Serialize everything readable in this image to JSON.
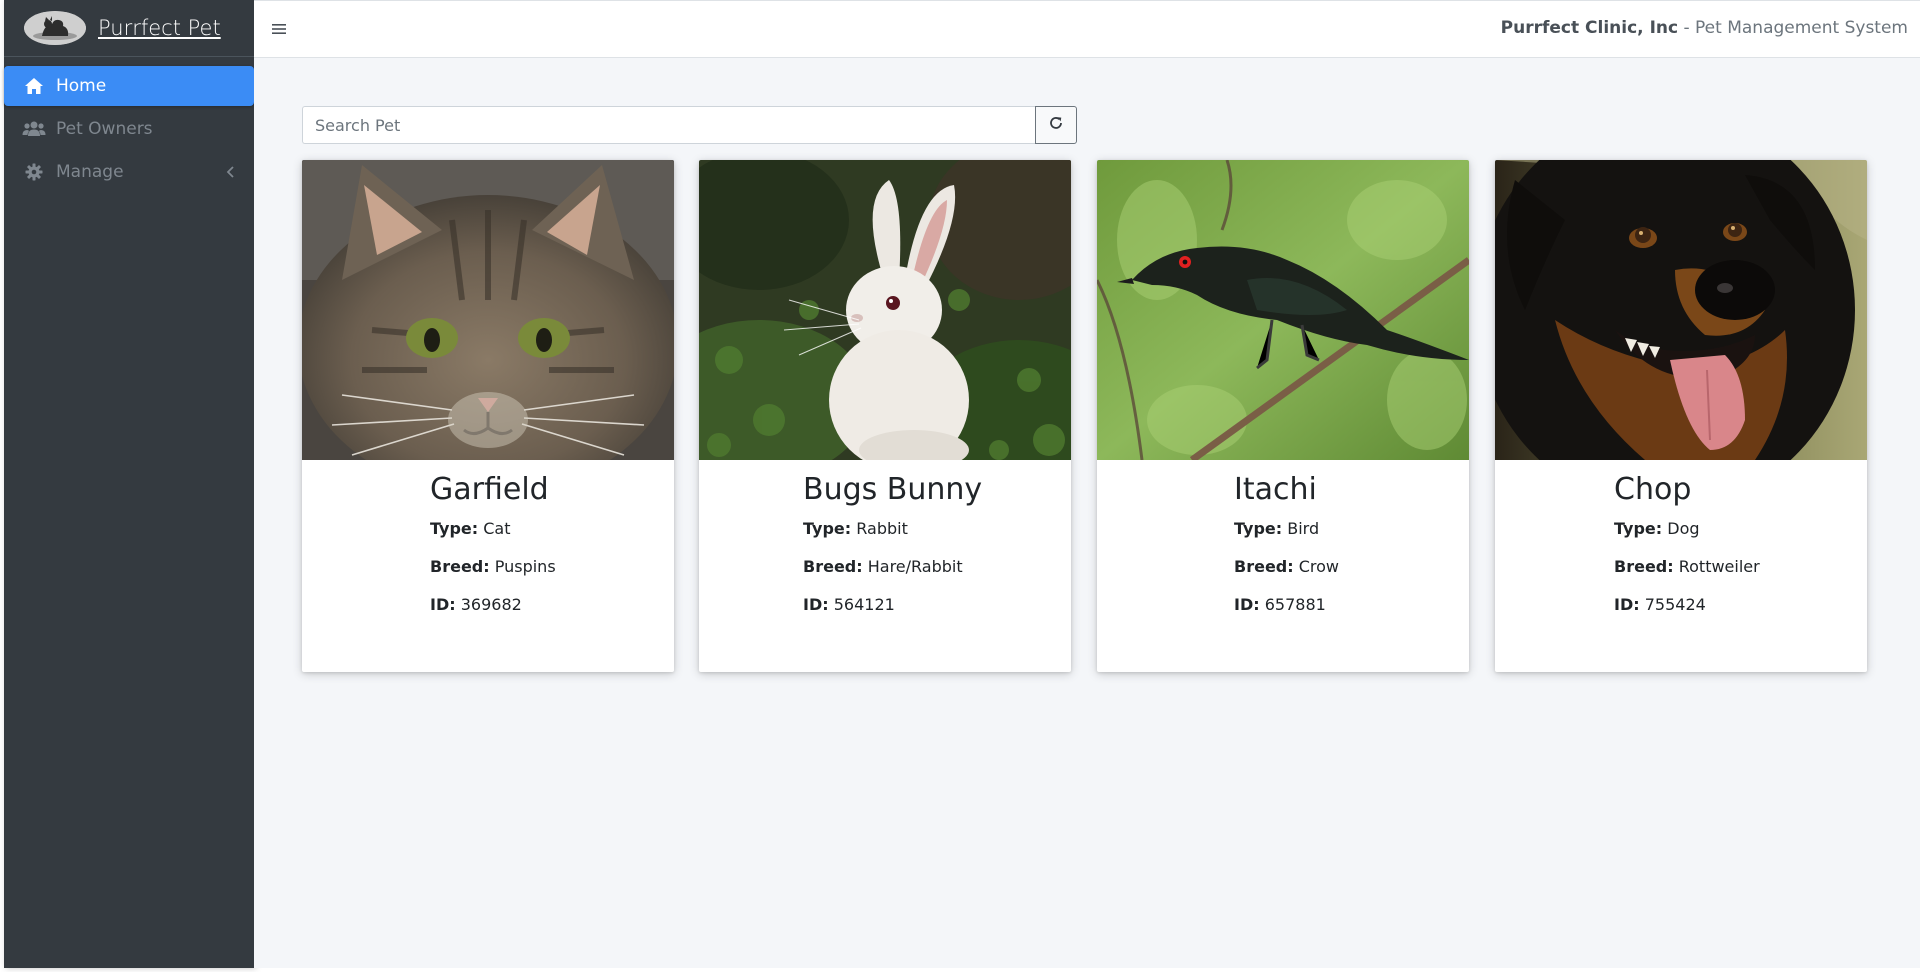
{
  "brand": {
    "name": "Purrfect Pet",
    "logo_icon": "pet-silhouette-logo"
  },
  "sidebar": {
    "items": [
      {
        "label": "Home",
        "icon": "home-icon",
        "active": true
      },
      {
        "label": "Pet Owners",
        "icon": "users-icon",
        "active": false
      },
      {
        "label": "Manage",
        "icon": "gear-icon",
        "active": false,
        "caret": "chevron-left-icon"
      }
    ]
  },
  "header": {
    "menu_icon": "hamburger-icon",
    "org": "Purrfect Clinic, Inc",
    "separator": " - ",
    "system": "Pet Management System"
  },
  "search": {
    "placeholder": "Search Pet",
    "value": "",
    "refresh_icon": "refresh-icon"
  },
  "labels": {
    "type": "Type:",
    "breed": "Breed:",
    "id": "ID:"
  },
  "pets": [
    {
      "name": "Garfield",
      "type": "Cat",
      "breed": "Puspins",
      "id": "369682"
    },
    {
      "name": "Bugs Bunny",
      "type": "Rabbit",
      "breed": "Hare/Rabbit",
      "id": "564121"
    },
    {
      "name": "Itachi",
      "type": "Bird",
      "breed": "Crow",
      "id": "657881"
    },
    {
      "name": "Chop",
      "type": "Dog",
      "breed": "Rottweiler",
      "id": "755424"
    }
  ],
  "colors": {
    "sidebar_bg": "#343a40",
    "active_nav": "#3b8cf5",
    "content_bg": "#f4f6f9"
  }
}
